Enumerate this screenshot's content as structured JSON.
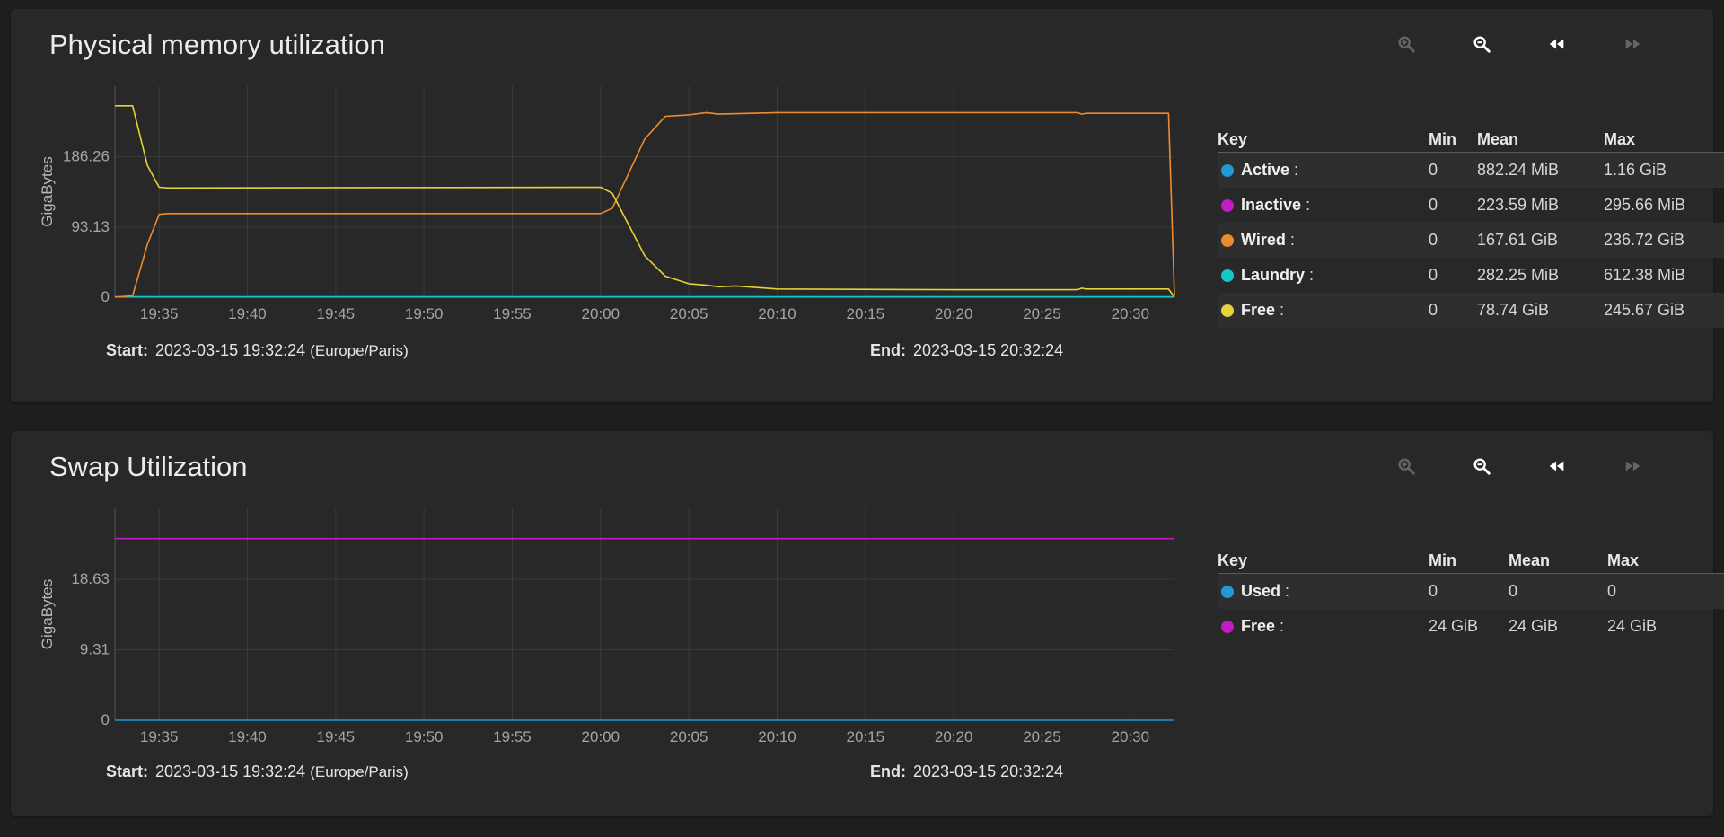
{
  "memory": {
    "title": "Physical memory utilization",
    "range": {
      "start_label": "Start:",
      "start_value": "2023-03-15 19:32:24",
      "timezone": "(Europe/Paris)",
      "end_label": "End:",
      "end_value": "2023-03-15 20:32:24"
    },
    "legend": {
      "headers": [
        "Key",
        "Min",
        "Mean",
        "Max"
      ],
      "rows": [
        {
          "name": "Active",
          "sep": ":",
          "min": "0",
          "mean": "882.24 MiB",
          "max": "1.16 GiB",
          "color": "#1f9ad6"
        },
        {
          "name": "Inactive",
          "sep": ":",
          "min": "0",
          "mean": "223.59 MiB",
          "max": "295.66 MiB",
          "color": "#c01bc4"
        },
        {
          "name": "Wired",
          "sep": ":",
          "min": "0",
          "mean": "167.61 GiB",
          "max": "236.72 GiB",
          "color": "#ee8a2e"
        },
        {
          "name": "Laundry",
          "sep": ":",
          "min": "0",
          "mean": "282.25 MiB",
          "max": "612.38 MiB",
          "color": "#17c6c8"
        },
        {
          "name": "Free",
          "sep": ":",
          "min": "0",
          "mean": "78.74 GiB",
          "max": "245.67 GiB",
          "color": "#e6d136"
        }
      ]
    }
  },
  "swap": {
    "title": "Swap Utilization",
    "range": {
      "start_label": "Start:",
      "start_value": "2023-03-15 19:32:24",
      "timezone": "(Europe/Paris)",
      "end_label": "End:",
      "end_value": "2023-03-15 20:32:24"
    },
    "legend": {
      "headers": [
        "Key",
        "Min",
        "Mean",
        "Max"
      ],
      "rows": [
        {
          "name": "Used",
          "sep": ":",
          "min": "0",
          "mean": "0",
          "max": "0",
          "color": "#1f9ad6"
        },
        {
          "name": "Free",
          "sep": ":",
          "min": "24 GiB",
          "mean": "24 GiB",
          "max": "24 GiB",
          "color": "#c01bc4"
        }
      ]
    }
  },
  "toolbar": {
    "buttons": [
      {
        "icon": "zoom-in-icon",
        "enabled": false
      },
      {
        "icon": "zoom-out-icon",
        "enabled": true
      },
      {
        "icon": "rewind-icon",
        "enabled": true
      },
      {
        "icon": "fast-forward-icon",
        "enabled": false
      }
    ]
  },
  "chart_data": [
    {
      "type": "line",
      "ylabel": "GigaBytes",
      "xlabel": "",
      "x_ticks": [
        "19:35",
        "19:40",
        "19:45",
        "19:50",
        "19:55",
        "20:00",
        "20:05",
        "20:10",
        "20:15",
        "20:20",
        "20:25",
        "20:30"
      ],
      "y_ticks": [
        0,
        93.13,
        186.26
      ],
      "ylim": [
        0,
        280
      ],
      "xlim": [
        "19:32:30",
        "20:32:30"
      ],
      "series": [
        {
          "name": "Active",
          "color": "#1f9ad6",
          "points": [
            [
              "19:32:30",
              0.5
            ],
            [
              "20:32:30",
              0.5
            ]
          ]
        },
        {
          "name": "Inactive",
          "color": "#c01bc4",
          "points": [
            [
              "19:32:30",
              0.2
            ],
            [
              "20:32:30",
              0.2
            ]
          ]
        },
        {
          "name": "Laundry",
          "color": "#17c6c8",
          "points": [
            [
              "19:32:30",
              0.3
            ],
            [
              "20:32:30",
              0.3
            ]
          ]
        },
        {
          "name": "Wired",
          "color": "#ee8a2e",
          "points": [
            [
              "19:32:30",
              0
            ],
            [
              "19:33:30",
              2
            ],
            [
              "19:34:20",
              70
            ],
            [
              "19:35:00",
              110
            ],
            [
              "19:35:30",
              111
            ],
            [
              "20:00:00",
              111
            ],
            [
              "20:00:40",
              118
            ],
            [
              "20:02:30",
              210
            ],
            [
              "20:03:40",
              240
            ],
            [
              "20:05:00",
              242
            ],
            [
              "20:06:00",
              245
            ],
            [
              "20:06:40",
              243
            ],
            [
              "20:08:30",
              244
            ],
            [
              "20:10:00",
              245
            ],
            [
              "20:20:00",
              245
            ],
            [
              "20:27:00",
              245
            ],
            [
              "20:27:15",
              243
            ],
            [
              "20:27:30",
              244
            ],
            [
              "20:32:10",
              244
            ],
            [
              "20:32:30",
              2
            ]
          ]
        },
        {
          "name": "Free",
          "color": "#e6d136",
          "points": [
            [
              "19:32:30",
              254
            ],
            [
              "19:33:30",
              254
            ],
            [
              "19:34:20",
              175
            ],
            [
              "19:35:00",
              146
            ],
            [
              "19:35:30",
              145
            ],
            [
              "20:00:00",
              146
            ],
            [
              "20:00:40",
              138
            ],
            [
              "20:02:30",
              55
            ],
            [
              "20:03:40",
              28
            ],
            [
              "20:05:00",
              18
            ],
            [
              "20:06:00",
              16
            ],
            [
              "20:06:40",
              14
            ],
            [
              "20:07:40",
              15
            ],
            [
              "20:10:00",
              11
            ],
            [
              "20:20:00",
              10
            ],
            [
              "20:27:00",
              10
            ],
            [
              "20:27:15",
              12
            ],
            [
              "20:27:30",
              11
            ],
            [
              "20:32:10",
              11
            ],
            [
              "20:32:30",
              0
            ]
          ]
        }
      ]
    },
    {
      "type": "line",
      "ylabel": "GigaBytes",
      "xlabel": "",
      "x_ticks": [
        "19:35",
        "19:40",
        "19:45",
        "19:50",
        "19:55",
        "20:00",
        "20:05",
        "20:10",
        "20:15",
        "20:20",
        "20:25",
        "20:30"
      ],
      "y_ticks": [
        0,
        9.31,
        18.63
      ],
      "ylim": [
        0,
        28
      ],
      "xlim": [
        "19:32:30",
        "20:32:30"
      ],
      "series": [
        {
          "name": "Used",
          "color": "#1f9ad6",
          "points": [
            [
              "19:32:30",
              0
            ],
            [
              "20:32:30",
              0
            ]
          ]
        },
        {
          "name": "Free",
          "color": "#c01bc4",
          "points": [
            [
              "19:32:30",
              24
            ],
            [
              "20:32:30",
              24
            ]
          ]
        }
      ]
    }
  ]
}
